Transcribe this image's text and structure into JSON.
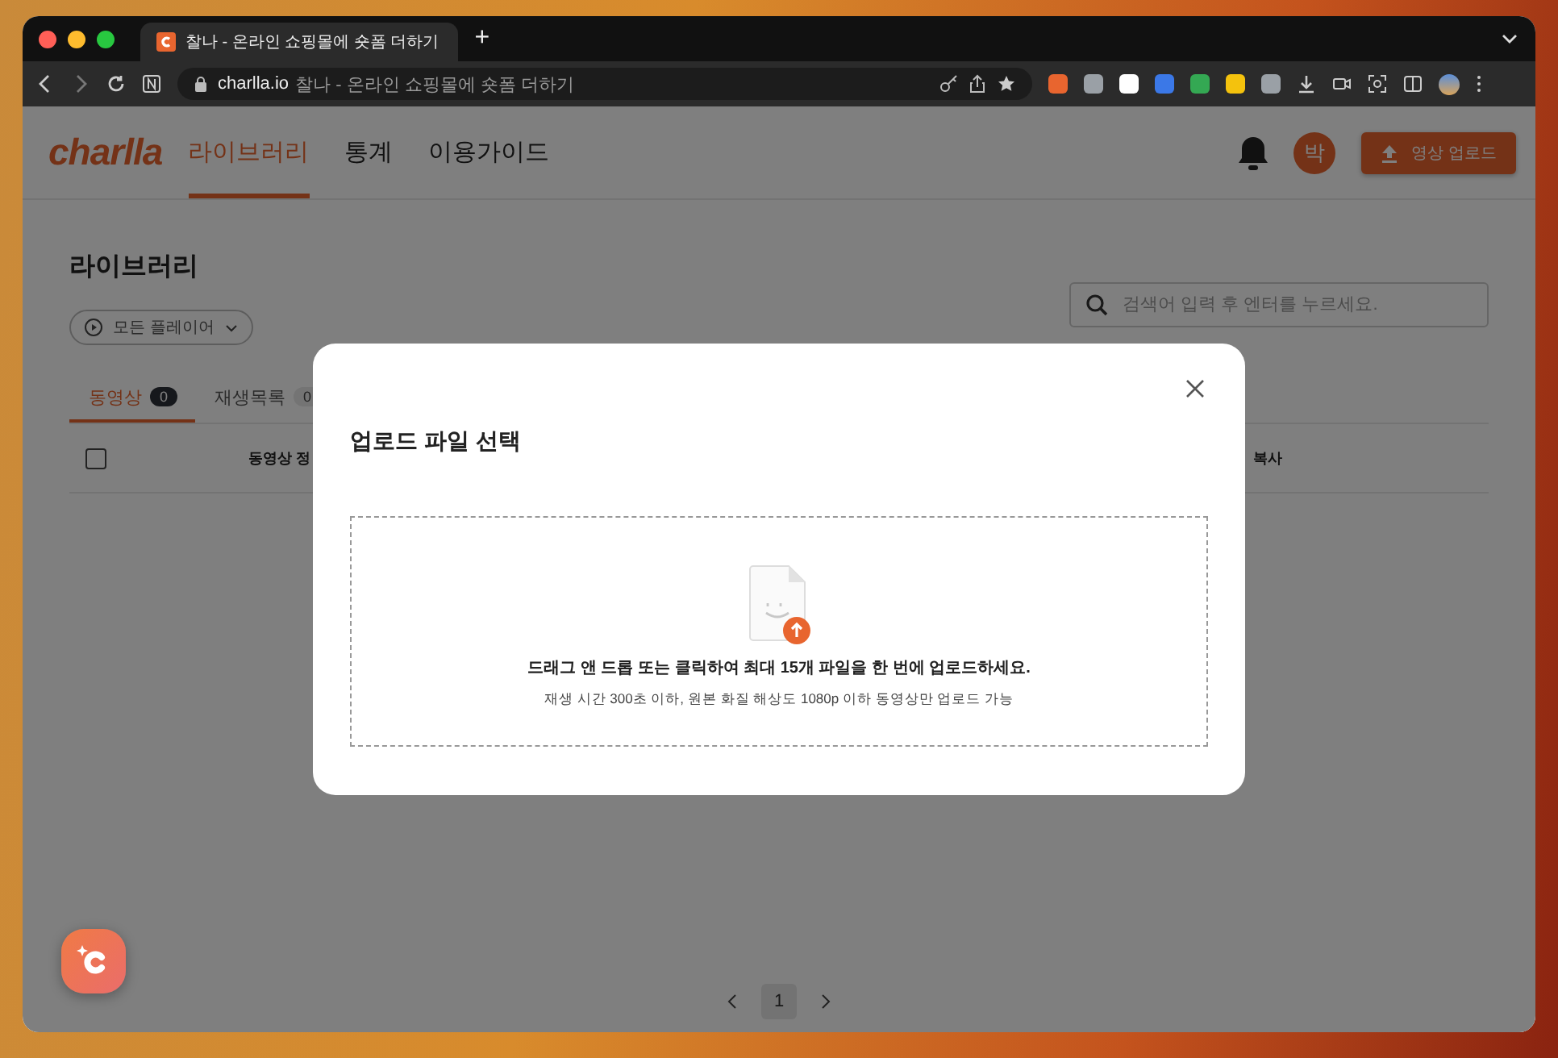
{
  "browser": {
    "tab_title": "찰나 - 온라인 쇼핑몰에 숏폼 더하기",
    "new_tab": "+",
    "url_domain": "charlla.io",
    "url_title": "찰나 - 온라인 쇼핑몰에 숏폼 더하기"
  },
  "header": {
    "logo": "charlla",
    "nav": [
      {
        "label": "라이브러리",
        "selected": true
      },
      {
        "label": "통계",
        "selected": false
      },
      {
        "label": "이용가이드",
        "selected": false
      }
    ],
    "avatar": "박",
    "upload_button": "영상 업로드"
  },
  "library": {
    "title": "라이브러리",
    "player_filter": "모든 플레이어",
    "search": {
      "placeholder": "검색어 입력 후 엔터를 누르세요."
    },
    "tabs": [
      {
        "label": "동영상",
        "count": "0",
        "selected": true
      },
      {
        "label": "재생목록",
        "count": "0",
        "selected": false
      }
    ],
    "table": {
      "select_all": {
        "checked": false
      },
      "columns": [
        "동영상 정",
        "복사"
      ]
    }
  },
  "pagination": {
    "pages": [
      {
        "label": "1",
        "selected": true
      }
    ]
  },
  "modal": {
    "title": "업로드 파일 선택",
    "dropzone": {
      "instruction": "드래그 앤 드롭 또는 클릭하여 최대 15개 파일을 한 번에 업로드하세요.",
      "note": "재생 시간 300초 이하, 원본 화질 해상도 1080p 이하 동영상만 업로드 가능"
    }
  }
}
